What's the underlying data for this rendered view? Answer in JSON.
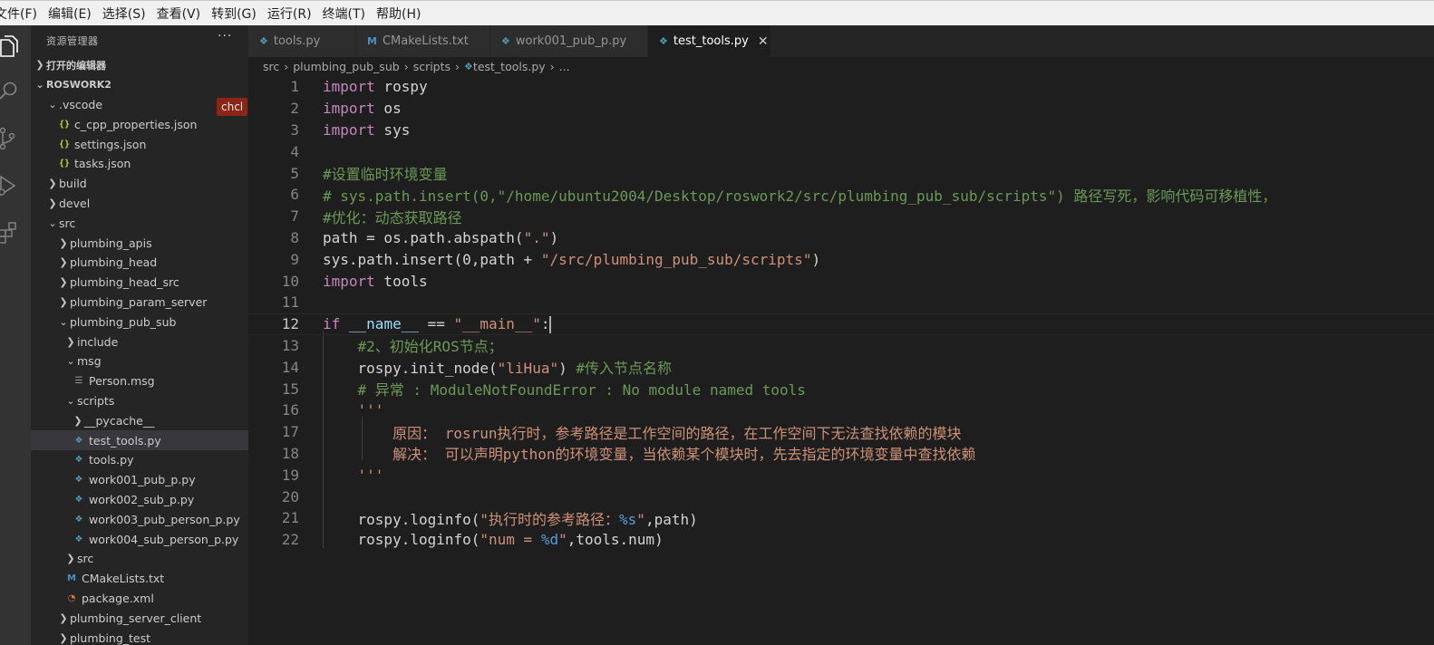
{
  "menubar": {
    "items": [
      "文件(F)",
      "编辑(E)",
      "选择(S)",
      "查看(V)",
      "转到(G)",
      "运行(R)",
      "终端(T)",
      "帮助(H)"
    ]
  },
  "activitybar": {
    "icons": [
      "files-icon",
      "search-icon",
      "source-control-icon",
      "run-debug-icon",
      "extensions-icon"
    ]
  },
  "sidebar": {
    "title": "资源管理器",
    "more": "···",
    "open_editors": "打开的编辑器",
    "workspace": "ROSWORK2",
    "chcl_badge": "chcl",
    "tree": [
      {
        "label": ".vscode",
        "indent": 1,
        "twisty": "open",
        "icon": ""
      },
      {
        "label": "c_cpp_properties.json",
        "indent": 2,
        "twisty": "",
        "icon": "json"
      },
      {
        "label": "settings.json",
        "indent": 2,
        "twisty": "",
        "icon": "json"
      },
      {
        "label": "tasks.json",
        "indent": 2,
        "twisty": "",
        "icon": "json"
      },
      {
        "label": "build",
        "indent": 1,
        "twisty": "closed",
        "icon": ""
      },
      {
        "label": "devel",
        "indent": 1,
        "twisty": "closed",
        "icon": ""
      },
      {
        "label": "src",
        "indent": 1,
        "twisty": "open",
        "icon": ""
      },
      {
        "label": "plumbing_apis",
        "indent": 2,
        "twisty": "closed",
        "icon": ""
      },
      {
        "label": "plumbing_head",
        "indent": 2,
        "twisty": "closed",
        "icon": ""
      },
      {
        "label": "plumbing_head_src",
        "indent": 2,
        "twisty": "closed",
        "icon": ""
      },
      {
        "label": "plumbing_param_server",
        "indent": 2,
        "twisty": "closed",
        "icon": ""
      },
      {
        "label": "plumbing_pub_sub",
        "indent": 2,
        "twisty": "open",
        "icon": ""
      },
      {
        "label": "include",
        "indent": 3,
        "twisty": "closed",
        "icon": ""
      },
      {
        "label": "msg",
        "indent": 3,
        "twisty": "open",
        "icon": ""
      },
      {
        "label": "Person.msg",
        "indent": 4,
        "twisty": "",
        "icon": "list"
      },
      {
        "label": "scripts",
        "indent": 3,
        "twisty": "open",
        "icon": ""
      },
      {
        "label": "__pycache__",
        "indent": 4,
        "twisty": "closed",
        "icon": ""
      },
      {
        "label": "test_tools.py",
        "indent": 4,
        "twisty": "",
        "icon": "py",
        "selected": true
      },
      {
        "label": "tools.py",
        "indent": 4,
        "twisty": "",
        "icon": "py"
      },
      {
        "label": "work001_pub_p.py",
        "indent": 4,
        "twisty": "",
        "icon": "py"
      },
      {
        "label": "work002_sub_p.py",
        "indent": 4,
        "twisty": "",
        "icon": "py"
      },
      {
        "label": "work003_pub_person_p.py",
        "indent": 4,
        "twisty": "",
        "icon": "py"
      },
      {
        "label": "work004_sub_person_p.py",
        "indent": 4,
        "twisty": "",
        "icon": "py"
      },
      {
        "label": "src",
        "indent": 3,
        "twisty": "closed",
        "icon": ""
      },
      {
        "label": "CMakeLists.txt",
        "indent": 3,
        "twisty": "",
        "icon": "m"
      },
      {
        "label": "package.xml",
        "indent": 3,
        "twisty": "",
        "icon": "rss"
      },
      {
        "label": "plumbing_server_client",
        "indent": 2,
        "twisty": "closed",
        "icon": ""
      },
      {
        "label": "plumbing_test",
        "indent": 2,
        "twisty": "closed",
        "icon": ""
      }
    ]
  },
  "tabs": [
    {
      "label": "tools.py",
      "icon": "py",
      "active": false
    },
    {
      "label": "CMakeLists.txt",
      "icon": "m",
      "active": false
    },
    {
      "label": "work001_pub_p.py",
      "icon": "py",
      "active": false
    },
    {
      "label": "test_tools.py",
      "icon": "py",
      "active": true
    }
  ],
  "breadcrumb": [
    "src",
    "plumbing_pub_sub",
    "scripts",
    "test_tools.py",
    "..."
  ],
  "editor": {
    "lines": [
      [
        [
          "kw",
          "import"
        ],
        [
          "txt",
          " rospy"
        ]
      ],
      [
        [
          "kw",
          "import"
        ],
        [
          "txt",
          " os"
        ]
      ],
      [
        [
          "kw",
          "import"
        ],
        [
          "txt",
          " sys"
        ]
      ],
      [],
      [
        [
          "cmt",
          "#设置临时环境变量"
        ]
      ],
      [
        [
          "cmt",
          "# sys.path.insert(0,\"/home/ubuntu2004/Desktop/roswork2/src/plumbing_pub_sub/scripts\") 路径写死，影响代码可移植性，"
        ]
      ],
      [
        [
          "cmt",
          "#优化：动态获取路径"
        ]
      ],
      [
        [
          "txt",
          "path = os.path.abspath("
        ],
        [
          "str",
          "\".\""
        ],
        [
          "txt",
          ")"
        ]
      ],
      [
        [
          "txt",
          "sys.path.insert(0,path + "
        ],
        [
          "str",
          "\"/src/plumbing_pub_sub/scripts\""
        ],
        [
          "txt",
          ")"
        ]
      ],
      [
        [
          "kw",
          "import"
        ],
        [
          "txt",
          " tools"
        ]
      ],
      [],
      [
        [
          "kw",
          "if"
        ],
        [
          "txt",
          " "
        ],
        [
          "var",
          "__name__"
        ],
        [
          "txt",
          " == "
        ],
        [
          "str",
          "\"__main__\""
        ],
        [
          "txt",
          ":"
        ]
      ],
      [
        [
          "txt",
          "    "
        ],
        [
          "cmt",
          "#2、初始化ROS节点；"
        ]
      ],
      [
        [
          "txt",
          "    rospy.init_node("
        ],
        [
          "str",
          "\"liHua\""
        ],
        [
          "txt",
          ") "
        ],
        [
          "cmt",
          "#传入节点名称"
        ]
      ],
      [
        [
          "txt",
          "    "
        ],
        [
          "cmt",
          "# 异常 : ModuleNotFoundError : No module named tools"
        ]
      ],
      [
        [
          "txt",
          "    "
        ],
        [
          "str",
          "'''"
        ]
      ],
      [
        [
          "str",
          "        原因： rosrun执行时，参考路径是工作空间的路径，在工作空间下无法查找依赖的模块"
        ]
      ],
      [
        [
          "str",
          "        解决： 可以声明python的环境变量，当依赖某个模块时，先去指定的环境变量中查找依赖"
        ]
      ],
      [
        [
          "txt",
          "    "
        ],
        [
          "str",
          "'''"
        ]
      ],
      [],
      [
        [
          "txt",
          "    rospy.loginfo("
        ],
        [
          "str",
          "\"执行时的参考路径："
        ],
        [
          "fmt",
          "%s"
        ],
        [
          "str",
          "\""
        ],
        [
          "txt",
          ",path)"
        ]
      ],
      [
        [
          "txt",
          "    rospy.loginfo("
        ],
        [
          "str",
          "\"num = "
        ],
        [
          "fmt",
          "%d"
        ],
        [
          "str",
          "\""
        ],
        [
          "txt",
          ",tools.num)"
        ]
      ]
    ],
    "current_line": 12
  }
}
